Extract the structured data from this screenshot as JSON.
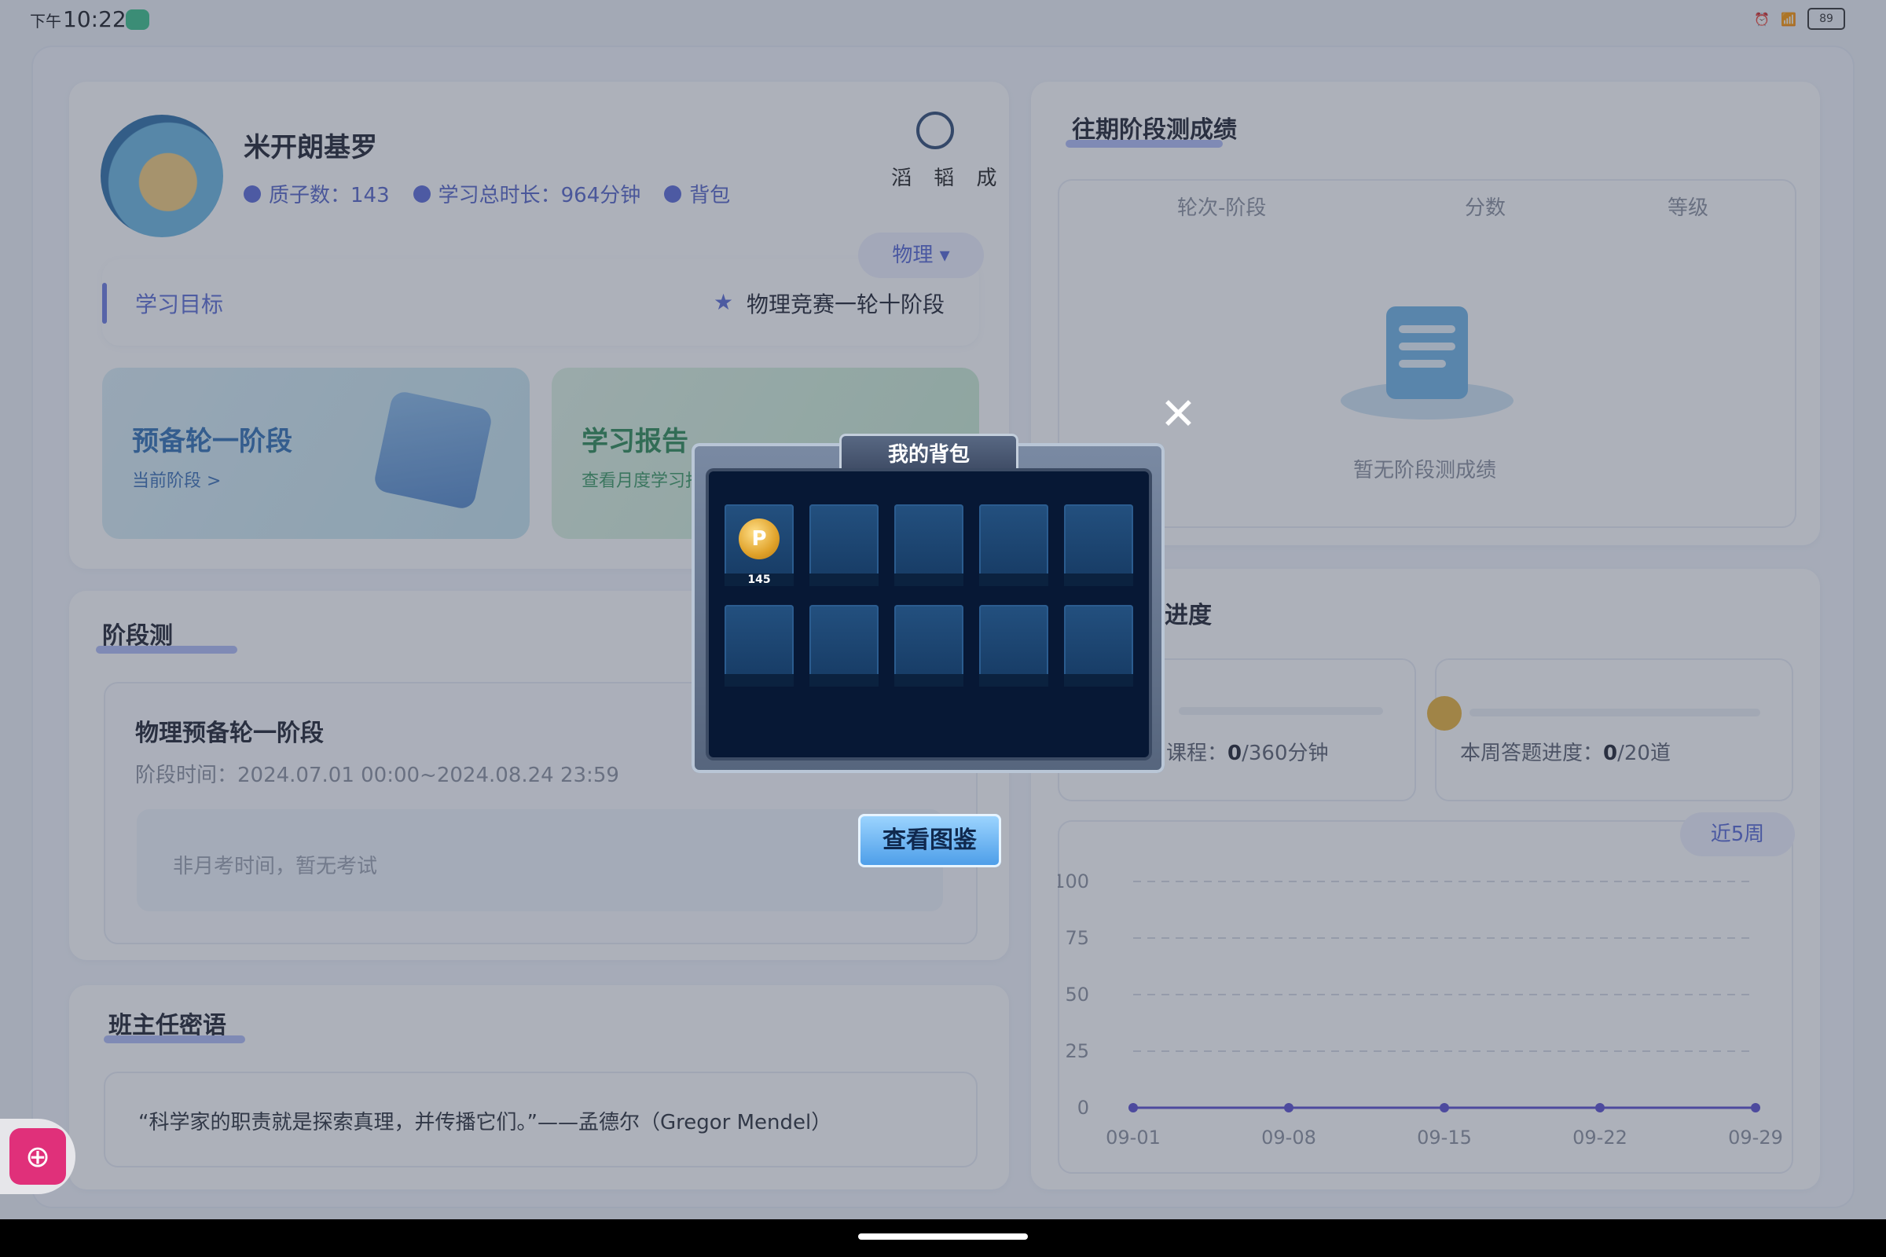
{
  "status_bar": {
    "ampm": "下午",
    "time": "10:22",
    "battery": "89"
  },
  "profile": {
    "name": "米开朗基罗",
    "quarks_label": "质子数：143",
    "study_time_label": "学习总时长：964分钟",
    "backpack_label": "背包",
    "motto": "滔 韬 成"
  },
  "subject_selector": {
    "value": "物理"
  },
  "goal": {
    "label": "学习目标",
    "value": "物理竞赛一轮十阶段"
  },
  "tiles": [
    {
      "title": "预备轮一阶段",
      "subtitle": "当前阶段 >"
    },
    {
      "title": "学习报告",
      "subtitle": "查看月度学习报告"
    }
  ],
  "stage_test": {
    "section_title": "阶段测",
    "name": "物理预备轮一阶段",
    "time": "阶段时间：2024.07.01 00:00~2024.08.24 23:59",
    "empty": "非月考时间，暂无考试"
  },
  "teacher": {
    "section_title": "班主任密语",
    "quote": "“科学家的职责就是探索真理，并传播它们。”——孟德尔（Gregor Mendel）"
  },
  "past_scores": {
    "section_title": "往期阶段测成绩",
    "columns": [
      "轮次-阶段",
      "分数",
      "等级"
    ],
    "empty": "暂无阶段测成绩"
  },
  "progress": {
    "section_title": "进度",
    "course_label": "课程：",
    "course_value": "0",
    "course_total": "/360分钟",
    "quiz_label": "本周答题进度：",
    "quiz_value": "0",
    "quiz_total": "/20道",
    "range_button": "近5周"
  },
  "chart_data": {
    "type": "line",
    "x": [
      "09-01",
      "09-08",
      "09-15",
      "09-22",
      "09-29"
    ],
    "series": [
      {
        "values": [
          0,
          0,
          0,
          0,
          0
        ]
      }
    ],
    "yticks": [
      0,
      25,
      50,
      75,
      100
    ],
    "ylim": [
      0,
      100
    ],
    "grid": true,
    "color": "#5a4fcf"
  },
  "backpack_modal": {
    "title": "我的背包",
    "items": [
      {
        "icon": "P",
        "count": "145"
      }
    ],
    "empty_slots": 9,
    "view_button": "查看图鉴"
  }
}
